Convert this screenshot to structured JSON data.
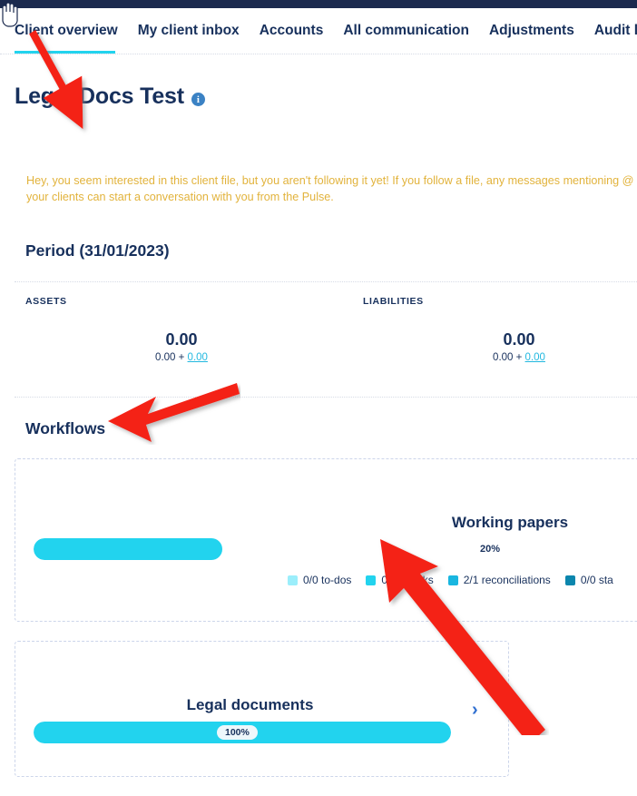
{
  "nav": {
    "tabs": [
      {
        "label": "Client overview",
        "active": true
      },
      {
        "label": "My client inbox",
        "active": false
      },
      {
        "label": "Accounts",
        "active": false
      },
      {
        "label": "All communication",
        "active": false
      },
      {
        "label": "Adjustments",
        "active": false
      },
      {
        "label": "Audit lo",
        "active": false
      }
    ],
    "accent_color": "#22d3ee"
  },
  "header": {
    "title": "Legal Docs Test",
    "info_icon": "info-icon"
  },
  "warning": {
    "text": "Hey, you seem interested in this client file, but you aren't following it yet! If you follow a file, any messages mentioning @ your clients can start a conversation with you from the Pulse.",
    "color": "#e2b33c"
  },
  "period": {
    "title": "Period (31/01/2023)",
    "columns": [
      {
        "label": "ASSETS",
        "value": "0.00",
        "sub_prefix": "0.00 + ",
        "sub_link": "0.00"
      },
      {
        "label": "LIABILITIES",
        "value": "0.00",
        "sub_prefix": "0.00 + ",
        "sub_link": "0.00"
      }
    ]
  },
  "workflows": {
    "title": "Workflows",
    "cards": [
      {
        "name": "working-papers",
        "heading": "Working papers",
        "percent_label": "20%",
        "legend": [
          {
            "label": "0/0 to-dos",
            "color": "#9beefb"
          },
          {
            "label": "0/0 checks",
            "color": "#22d3ee"
          },
          {
            "label": "2/1 reconciliations",
            "color": "#19b6e0"
          },
          {
            "label": "0/0 sta",
            "color": "#0b86ad"
          }
        ]
      },
      {
        "name": "legal-documents",
        "heading": "Legal documents",
        "percent_label": "100%",
        "chevron": "chevron-right-icon"
      }
    ]
  },
  "annotations": {
    "arrow_color": "#f42315",
    "arrows": [
      {
        "name": "arrow-to-client-overview-tab"
      },
      {
        "name": "arrow-to-workflows-heading"
      },
      {
        "name": "arrow-to-legal-documents-card"
      }
    ]
  }
}
